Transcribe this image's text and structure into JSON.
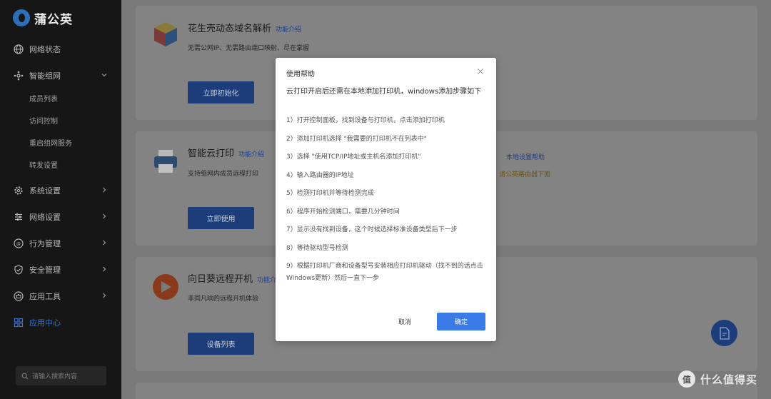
{
  "app": {
    "brand": "蒲公英"
  },
  "sidebar": {
    "items": [
      {
        "label": "网络状态",
        "icon": "globe-icon"
      },
      {
        "label": "智能组网",
        "icon": "network-icon",
        "expanded": true,
        "children": [
          "成员列表",
          "访问控制",
          "重启组网服务",
          "转发设置"
        ]
      },
      {
        "label": "系统设置",
        "icon": "gear-icon"
      },
      {
        "label": "网络设置",
        "icon": "sliders-icon"
      },
      {
        "label": "行为管理",
        "icon": "behavior-icon"
      },
      {
        "label": "安全管理",
        "icon": "shield-icon"
      },
      {
        "label": "应用工具",
        "icon": "briefcase-icon"
      },
      {
        "label": "应用中心",
        "icon": "grid-icon",
        "active": true
      }
    ],
    "search_placeholder": "请输入搜索内容"
  },
  "cards": [
    {
      "title": "花生壳动态域名解析",
      "link": "功能介绍",
      "desc": "无需公网IP、无需路由端口映射、尽在掌握",
      "button": "立即初始化"
    },
    {
      "title": "智能云打印",
      "link": "功能介绍",
      "desc": "支持组网内成员远程打印",
      "button": "立即使用",
      "side_link": "本地设置帮助",
      "side_note": "请公英路由器下面"
    },
    {
      "title": "向日葵远程开机",
      "link": "功能介绍",
      "desc": "非同凡响的远程开机体验",
      "button": "设备列表"
    }
  ],
  "modal": {
    "title": "使用帮助",
    "intro": "云打印开启后还需在本地添加打印机，windows添加步骤如下",
    "steps": [
      "1）打开控制面板，找到设备与打印机，点击添加打印机",
      "2）添加打印机选择 \"我需要的打印机不在列表中\"",
      "3）选择 \"使用TCP/IP地址或主机名添加打印机\"",
      "4）输入路由器的IP地址",
      "5）检测打印机并等待检测完成",
      "6）程序开始检测端口，需要几分钟时间",
      "7）显示没有找到设备，这个时候选择标准设备类型后下一步",
      "8）等待驱动型号检测",
      "9）根据打印机厂商和设备型号安装相应打印机驱动（找不到的话点击Windows更新）然后一直下一步"
    ],
    "cancel": "取消",
    "ok": "确定"
  },
  "watermark": {
    "badge": "值",
    "text": "什么值得买"
  },
  "colors": {
    "primary": "#3b7be8",
    "sidebar_bg": "#161616",
    "overlay": "#7a7a7a"
  }
}
